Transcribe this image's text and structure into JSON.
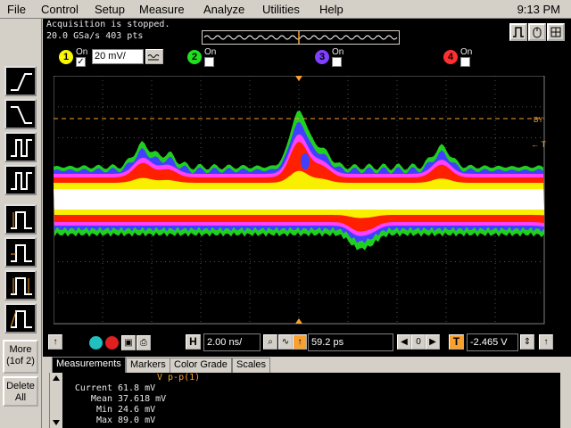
{
  "menu": {
    "items": [
      "File",
      "Control",
      "Setup",
      "Measure",
      "Analyze",
      "Utilities",
      "Help"
    ],
    "clock": "9:13 PM"
  },
  "status": {
    "line1": "Acquisition is stopped.",
    "line2": "20.0 GSa/s   403 pts"
  },
  "left_toolbar": {
    "more_label_1": "More",
    "more_label_2": "(1of 2)",
    "delete_label_1": "Delete",
    "delete_label_2": "All"
  },
  "channels": [
    {
      "number": "1",
      "on_label": "On",
      "checked": true,
      "scale": "20 mV/",
      "color": "#f8f800"
    },
    {
      "number": "2",
      "on_label": "On",
      "checked": false,
      "color": "#20e020"
    },
    {
      "number": "3",
      "on_label": "On",
      "checked": false,
      "color": "#8040ff"
    },
    {
      "number": "4",
      "on_label": "On",
      "checked": false,
      "color": "#ff3030"
    }
  ],
  "graticule": {
    "marker_by_label": "BY",
    "trigger_label": "← T"
  },
  "timebase": {
    "h_label": "H",
    "timebase_value": "2.00 ns/",
    "delay_value": "59.2 ps",
    "t_label": "T",
    "trigger_level": "-2.465 V"
  },
  "tabs": [
    "Measurements",
    "Markers",
    "Color Grade",
    "Scales"
  ],
  "measurements": {
    "title": "V p-p(1)",
    "rows": [
      {
        "label": "Current",
        "value": "61.8 mV"
      },
      {
        "label": "Mean",
        "value": "37.618 mV"
      },
      {
        "label": "Min",
        "value": "24.6 mV"
      },
      {
        "label": "Max",
        "value": "89.0 mV"
      }
    ]
  },
  "colors": {
    "waveform_core": "#ffffff",
    "waveform_yellow": "#f8f000",
    "waveform_red": "#ff2000",
    "waveform_magenta": "#ff40ff",
    "waveform_blue": "#4040ff",
    "waveform_green": "#20d020",
    "marker_orange": "#f8a030"
  }
}
